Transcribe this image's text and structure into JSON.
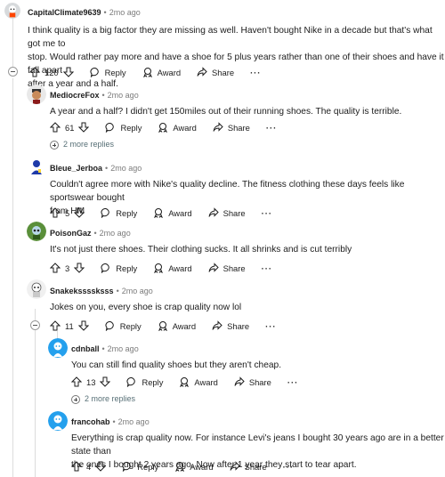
{
  "labels": {
    "reply": "Reply",
    "award": "Award",
    "share": "Share",
    "more": "···",
    "dot": "•"
  },
  "comments": [
    {
      "username": "CapitalClimate9639",
      "time": "2mo ago",
      "lines": [
        "I think quality is a big factor they are missing as well. Haven't bought Nike in a decade but that's what got me to",
        "stop. Would rather pay more and have a shoe for 5 plus years rather than one of their shoes and have it fall apart",
        "after a year and a half."
      ],
      "votes": "120"
    },
    {
      "username": "MediocreFox",
      "time": "2mo ago",
      "lines": [
        "A year and a half? I didn't get 150miles out of their running shoes. The quality is terrible."
      ],
      "votes": "61",
      "more_replies": "2 more replies"
    },
    {
      "username": "Bleue_Jerboa",
      "time": "2mo ago",
      "lines": [
        "Couldn't agree more with Nike's quality decline. The fitness clothing these days feels like sportswear bought",
        "from HM"
      ],
      "votes": "5"
    },
    {
      "username": "PoisonGaz",
      "time": "2mo ago",
      "lines": [
        "It's not just there shoes. Their clothing sucks. It all shrinks and is cut terribly"
      ],
      "votes": "3"
    },
    {
      "username": "Snakekssssksss",
      "time": "2mo ago",
      "lines": [
        "Jokes on you, every shoe is crap quality now lol"
      ],
      "votes": "11"
    },
    {
      "username": "cdnball",
      "time": "2mo ago",
      "lines": [
        "You can still find quality shoes but they aren't cheap."
      ],
      "votes": "13",
      "more_replies": "2 more replies"
    },
    {
      "username": "francohab",
      "time": "2mo ago",
      "lines": [
        "Everything is crap quality now. For instance Levi's jeans I bought 30 years ago are in a better state than",
        "the ones I bought 2 years ago. Now after 1 year they start to tear apart."
      ],
      "votes": "4"
    }
  ],
  "colors": {
    "meta": "#7c7c7c",
    "thread": "#dcdcdc",
    "avatar_blue": "#24a0ed"
  }
}
